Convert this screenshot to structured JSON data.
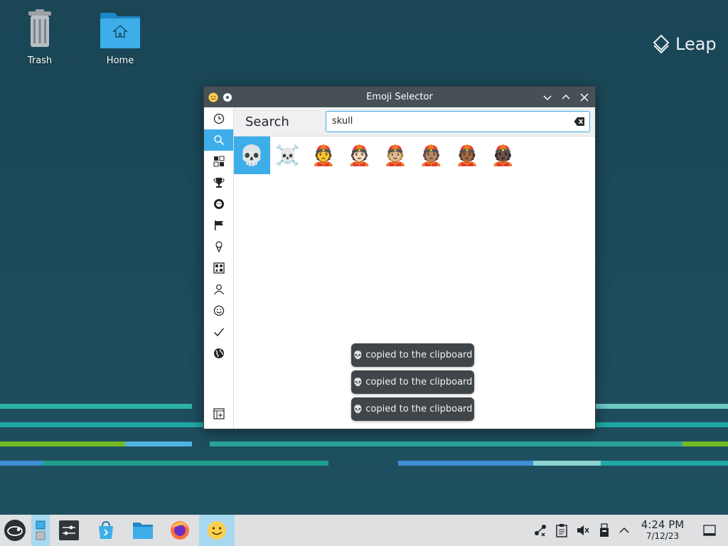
{
  "desktop": {
    "icons": [
      {
        "label": "Trash"
      },
      {
        "label": "Home"
      }
    ],
    "branding": "Leap"
  },
  "window": {
    "title": "Emoji Selector",
    "sidebar": [
      {
        "icon": "clock-icon",
        "label": "Recent"
      },
      {
        "icon": "search-icon",
        "label": "Search",
        "active": true
      },
      {
        "icon": "objects-icon",
        "label": "All"
      },
      {
        "icon": "trophy-icon",
        "label": "Activities"
      },
      {
        "icon": "lion-icon",
        "label": "Animals"
      },
      {
        "icon": "flag-icon",
        "label": "Flags"
      },
      {
        "icon": "icecream-icon",
        "label": "Food"
      },
      {
        "icon": "symbols-icon",
        "label": "Objects"
      },
      {
        "icon": "person-icon",
        "label": "People"
      },
      {
        "icon": "smiley-icon",
        "label": "Smileys"
      },
      {
        "icon": "checkmark-icon",
        "label": "Symbols"
      },
      {
        "icon": "globe-icon",
        "label": "Travel"
      }
    ],
    "heading": "Search",
    "search": {
      "value": "skull"
    },
    "results": [
      "💀",
      "☠️",
      "👲",
      "👲🏻",
      "👲🏼",
      "👲🏽",
      "👲🏾",
      "👲🏿"
    ],
    "toasts": [
      {
        "icon": "💀",
        "text": "copied to the clipboard"
      },
      {
        "icon": "💀",
        "text": "copied to the clipboard"
      },
      {
        "icon": "💀",
        "text": "copied to the clipboard"
      }
    ]
  },
  "taskbar": {
    "clock": {
      "time": "4:24 PM",
      "date": "7/12/23"
    }
  },
  "colors": {
    "accent": "#3daee9",
    "titlebar": "#475057",
    "wallpaper": "#1d4a5a",
    "taskbar": "#dee0e2"
  }
}
